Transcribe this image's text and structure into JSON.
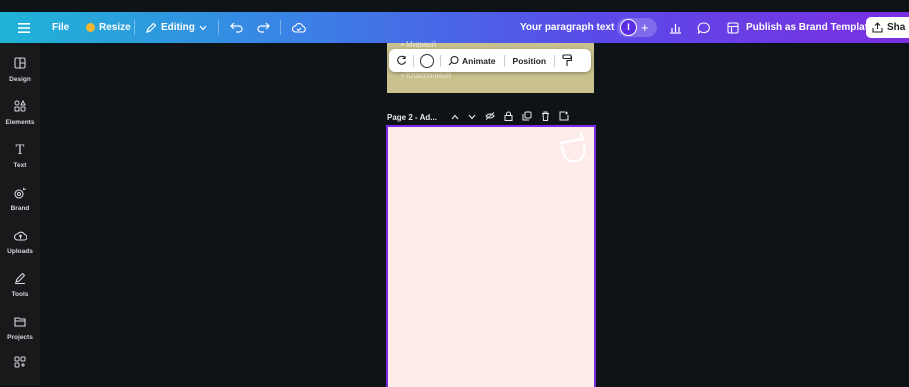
{
  "topbar": {
    "file_label": "File",
    "resize_label": "Resize",
    "editing_label": "Editing",
    "paragraph_label": "Your paragraph text",
    "publish_label": "Publish as Brand Template",
    "share_label": "Sha",
    "colors": {
      "gradient_start": "#1fb4d6",
      "gradient_end": "#7a2fe0",
      "resize_dot": "#f5b82e"
    }
  },
  "sidebar": {
    "items": [
      {
        "label": "Design",
        "icon": "design-icon"
      },
      {
        "label": "Elements",
        "icon": "elements-icon"
      },
      {
        "label": "Text",
        "icon": "text-icon"
      },
      {
        "label": "Brand",
        "icon": "brand-icon"
      },
      {
        "label": "Uploads",
        "icon": "uploads-icon"
      },
      {
        "label": "Tools",
        "icon": "tools-icon"
      },
      {
        "label": "Projects",
        "icon": "projects-icon"
      },
      {
        "label": "",
        "icon": "apps-icon"
      }
    ]
  },
  "float_toolbar": {
    "animate_label": "Animate",
    "position_label": "Position"
  },
  "page1": {
    "faded_text_1": "• Мирный",
    "faded_text_2": "• Классичный",
    "background": "#c9c28f"
  },
  "page2": {
    "label": "Page 2 - Ad...",
    "background": "#fdecea",
    "border_color": "#7d2ae8"
  }
}
